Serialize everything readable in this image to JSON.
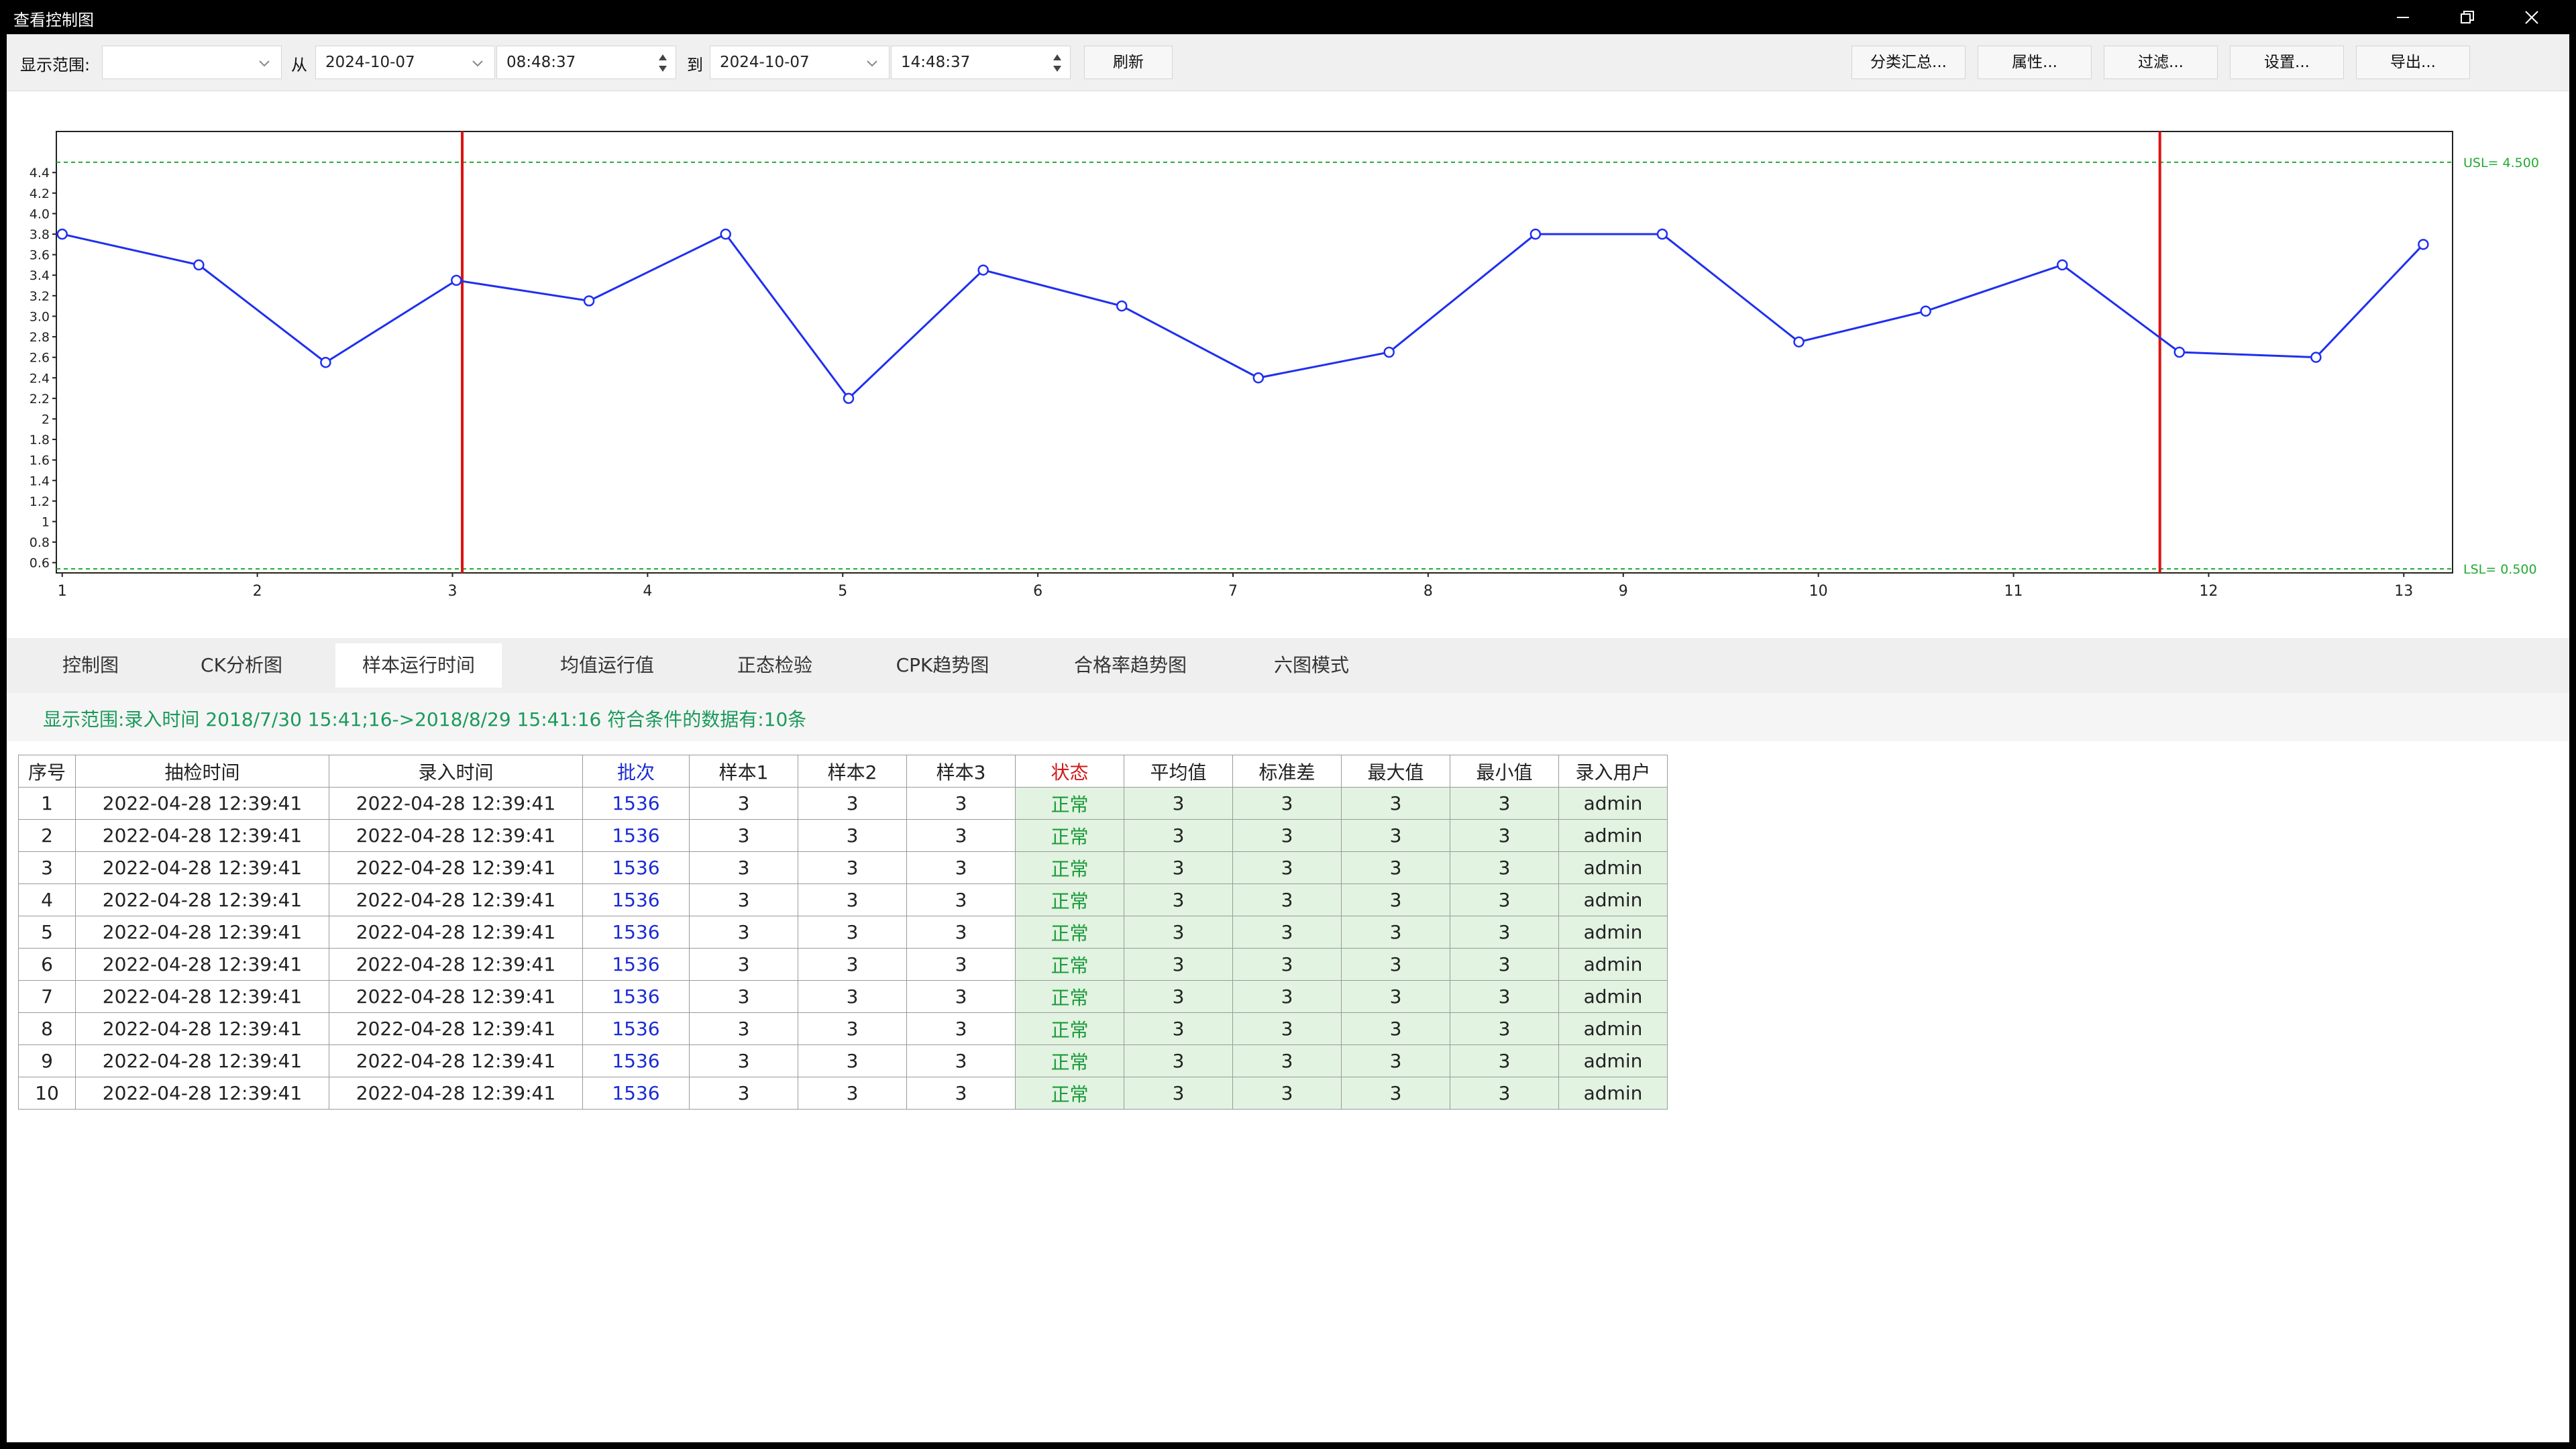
{
  "window": {
    "title": "查看控制图"
  },
  "toolbar": {
    "range_label": "显示范围:",
    "range_value": "",
    "from_label": "从",
    "from_date": "2024-10-07",
    "from_time": "08:48:37",
    "to_label": "到",
    "to_date": "2024-10-07",
    "to_time": "14:48:37",
    "refresh": "刷新",
    "buttons": [
      "分类汇总...",
      "属性...",
      "过滤...",
      "设置...",
      "导出..."
    ]
  },
  "chart_data": {
    "type": "line",
    "x": [
      1,
      1.7,
      2.35,
      3.02,
      3.7,
      4.4,
      5.03,
      5.72,
      6.43,
      7.13,
      7.8,
      8.55,
      9.2,
      9.9,
      10.55,
      11.25,
      11.85,
      12.55,
      13.1
    ],
    "values": [
      3.8,
      3.5,
      2.55,
      3.35,
      3.15,
      3.8,
      2.2,
      3.45,
      3.1,
      2.4,
      2.65,
      3.8,
      3.8,
      2.75,
      3.05,
      3.5,
      2.65,
      2.6,
      3.7
    ],
    "xticks": [
      "1",
      "2",
      "3",
      "4",
      "5",
      "6",
      "7",
      "8",
      "9",
      "10",
      "11",
      "12",
      "13"
    ],
    "yticks": [
      "0.6",
      "0.8",
      "1",
      "1.2",
      "1.4",
      "1.6",
      "1.8",
      "2",
      "2.2",
      "2.4",
      "2.6",
      "2.8",
      "3.0",
      "3.2",
      "3.4",
      "3.6",
      "3.8",
      "4.0",
      "4.2",
      "4.4"
    ],
    "ylim": [
      0.5,
      4.8
    ],
    "usl": {
      "value": 4.5,
      "label": "USL= 4.500"
    },
    "lsl": {
      "value": 0.5,
      "label": "LSL= 0.500"
    },
    "red_lines_x": [
      3.05,
      11.75
    ],
    "series_color": "#1f2ff0",
    "limit_color": "#22aa33",
    "marker_color": "#dd1111"
  },
  "tabs": [
    "控制图",
    "CK分析图",
    "样本运行时间",
    "均值运行值",
    "正态检验",
    "CPK趋势图",
    "合格率趋势图",
    "六图模式"
  ],
  "active_tab": "样本运行时间",
  "filter_text": "显示范围:录入时间 2018/7/30 15:41;16->2018/8/29 15:41:16 符合条件的数据有:10条",
  "table": {
    "headers": [
      "序号",
      "抽检时间",
      "录入时间",
      "批次",
      "样本1",
      "样本2",
      "样本3",
      "状态",
      "平均值",
      "标准差",
      "最大值",
      "最小值",
      "录入用户"
    ],
    "rows": [
      [
        "1",
        "2022-04-28 12:39:41",
        "2022-04-28 12:39:41",
        "1536",
        "3",
        "3",
        "3",
        "正常",
        "3",
        "3",
        "3",
        "3",
        "admin"
      ],
      [
        "2",
        "2022-04-28 12:39:41",
        "2022-04-28 12:39:41",
        "1536",
        "3",
        "3",
        "3",
        "正常",
        "3",
        "3",
        "3",
        "3",
        "admin"
      ],
      [
        "3",
        "2022-04-28 12:39:41",
        "2022-04-28 12:39:41",
        "1536",
        "3",
        "3",
        "3",
        "正常",
        "3",
        "3",
        "3",
        "3",
        "admin"
      ],
      [
        "4",
        "2022-04-28 12:39:41",
        "2022-04-28 12:39:41",
        "1536",
        "3",
        "3",
        "3",
        "正常",
        "3",
        "3",
        "3",
        "3",
        "admin"
      ],
      [
        "5",
        "2022-04-28 12:39:41",
        "2022-04-28 12:39:41",
        "1536",
        "3",
        "3",
        "3",
        "正常",
        "3",
        "3",
        "3",
        "3",
        "admin"
      ],
      [
        "6",
        "2022-04-28 12:39:41",
        "2022-04-28 12:39:41",
        "1536",
        "3",
        "3",
        "3",
        "正常",
        "3",
        "3",
        "3",
        "3",
        "admin"
      ],
      [
        "7",
        "2022-04-28 12:39:41",
        "2022-04-28 12:39:41",
        "1536",
        "3",
        "3",
        "3",
        "正常",
        "3",
        "3",
        "3",
        "3",
        "admin"
      ],
      [
        "8",
        "2022-04-28 12:39:41",
        "2022-04-28 12:39:41",
        "1536",
        "3",
        "3",
        "3",
        "正常",
        "3",
        "3",
        "3",
        "3",
        "admin"
      ],
      [
        "9",
        "2022-04-28 12:39:41",
        "2022-04-28 12:39:41",
        "1536",
        "3",
        "3",
        "3",
        "正常",
        "3",
        "3",
        "3",
        "3",
        "admin"
      ],
      [
        "10",
        "2022-04-28 12:39:41",
        "2022-04-28 12:39:41",
        "1536",
        "3",
        "3",
        "3",
        "正常",
        "3",
        "3",
        "3",
        "3",
        "admin"
      ]
    ]
  }
}
